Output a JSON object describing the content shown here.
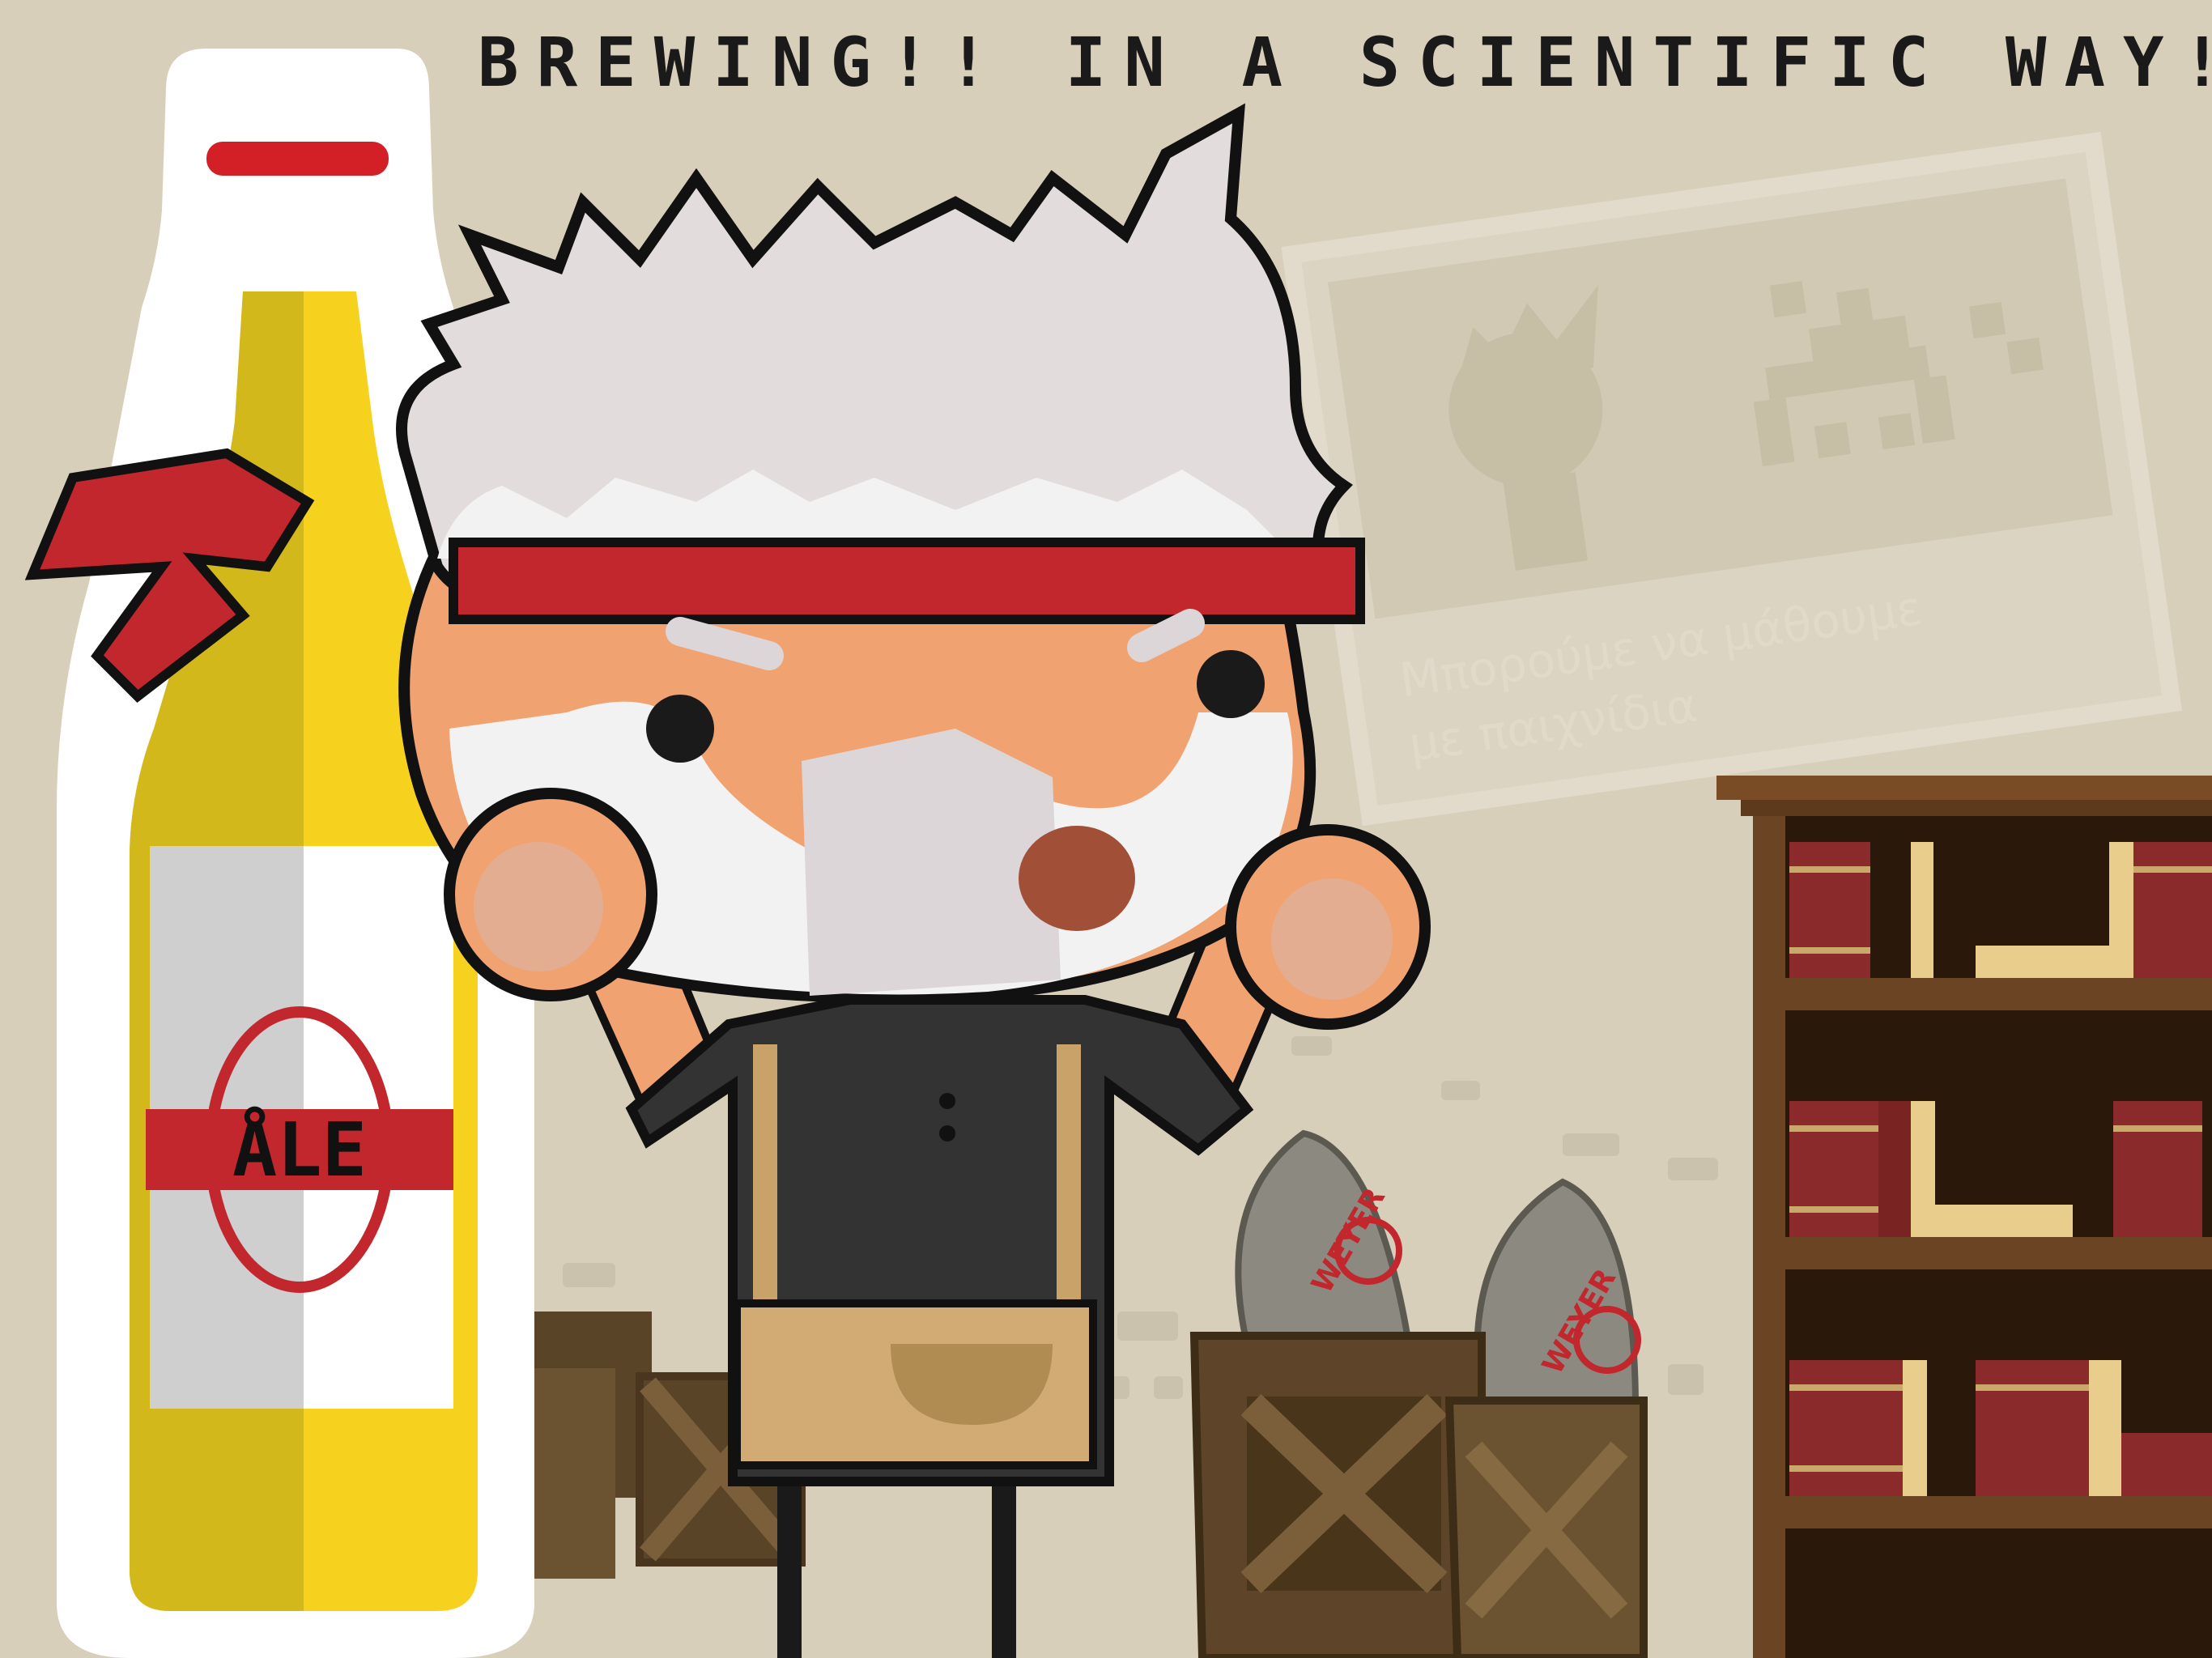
{
  "title": "BREWING!! IN A SCIENTIFIC WAY!",
  "poster": {
    "line1": "Μπορούμε να μάθουμε",
    "line2": "με παιχνίδια"
  },
  "bottle_label": "ÅLE",
  "sack_brand": "WEYER",
  "colors": {
    "background": "#d8cfbb",
    "headband": "#c1272d",
    "beer": "#f6d21f",
    "shelf": "#6b4423",
    "crate": "#5a4428",
    "sack": "#8c8a80"
  }
}
